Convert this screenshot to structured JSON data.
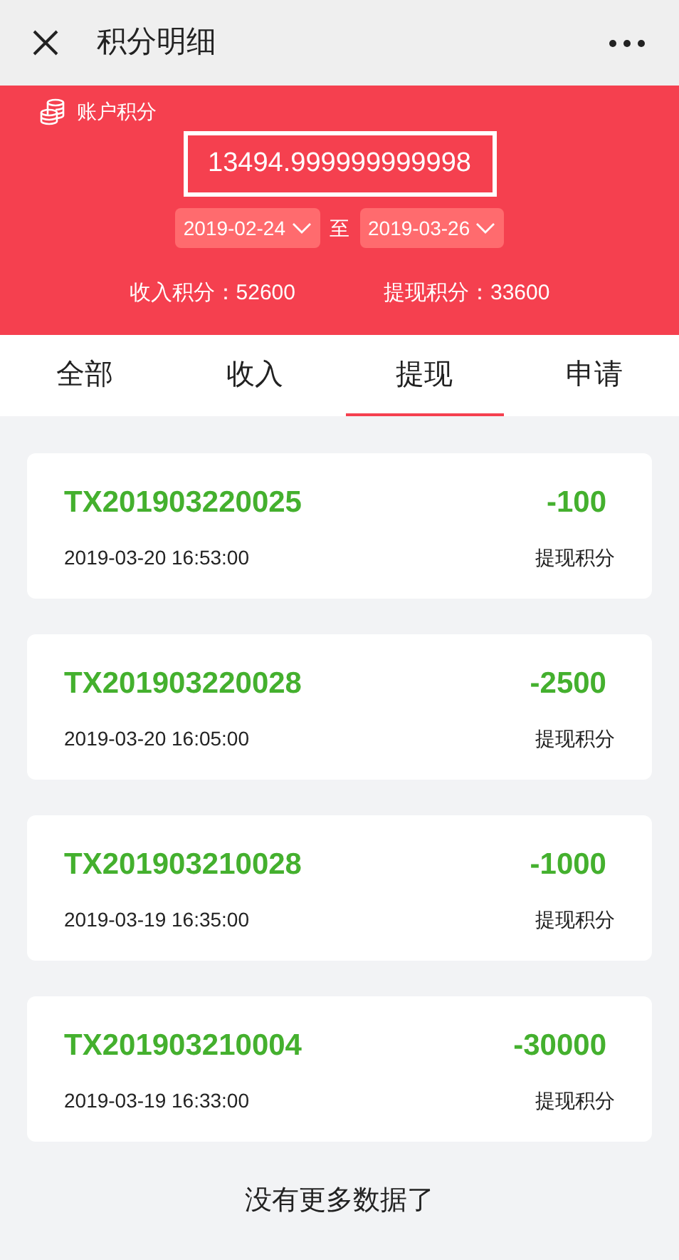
{
  "nav": {
    "title": "积分明细"
  },
  "account": {
    "label": "账户积分",
    "balance": "13494.999999999998",
    "start_date": "2019-02-24",
    "separator": "至",
    "end_date": "2019-03-26",
    "income": "收入积分：52600",
    "withdraw": "提现积分：33600"
  },
  "tabs": [
    {
      "label": "全部",
      "selected": false
    },
    {
      "label": "收入",
      "selected": false
    },
    {
      "label": "提现",
      "selected": true
    },
    {
      "label": "申请",
      "selected": false
    }
  ],
  "records": [
    {
      "id": "TX201903220025",
      "amount": "-100",
      "time": "2019-03-20 16:53:00",
      "type": "提现积分"
    },
    {
      "id": "TX201903220028",
      "amount": "-2500",
      "time": "2019-03-20 16:05:00",
      "type": "提现积分"
    },
    {
      "id": "TX201903210028",
      "amount": "-1000",
      "time": "2019-03-19 16:35:00",
      "type": "提现积分"
    },
    {
      "id": "TX201903210004",
      "amount": "-30000",
      "time": "2019-03-19 16:33:00",
      "type": "提现积分"
    }
  ],
  "footer": "没有更多数据了"
}
